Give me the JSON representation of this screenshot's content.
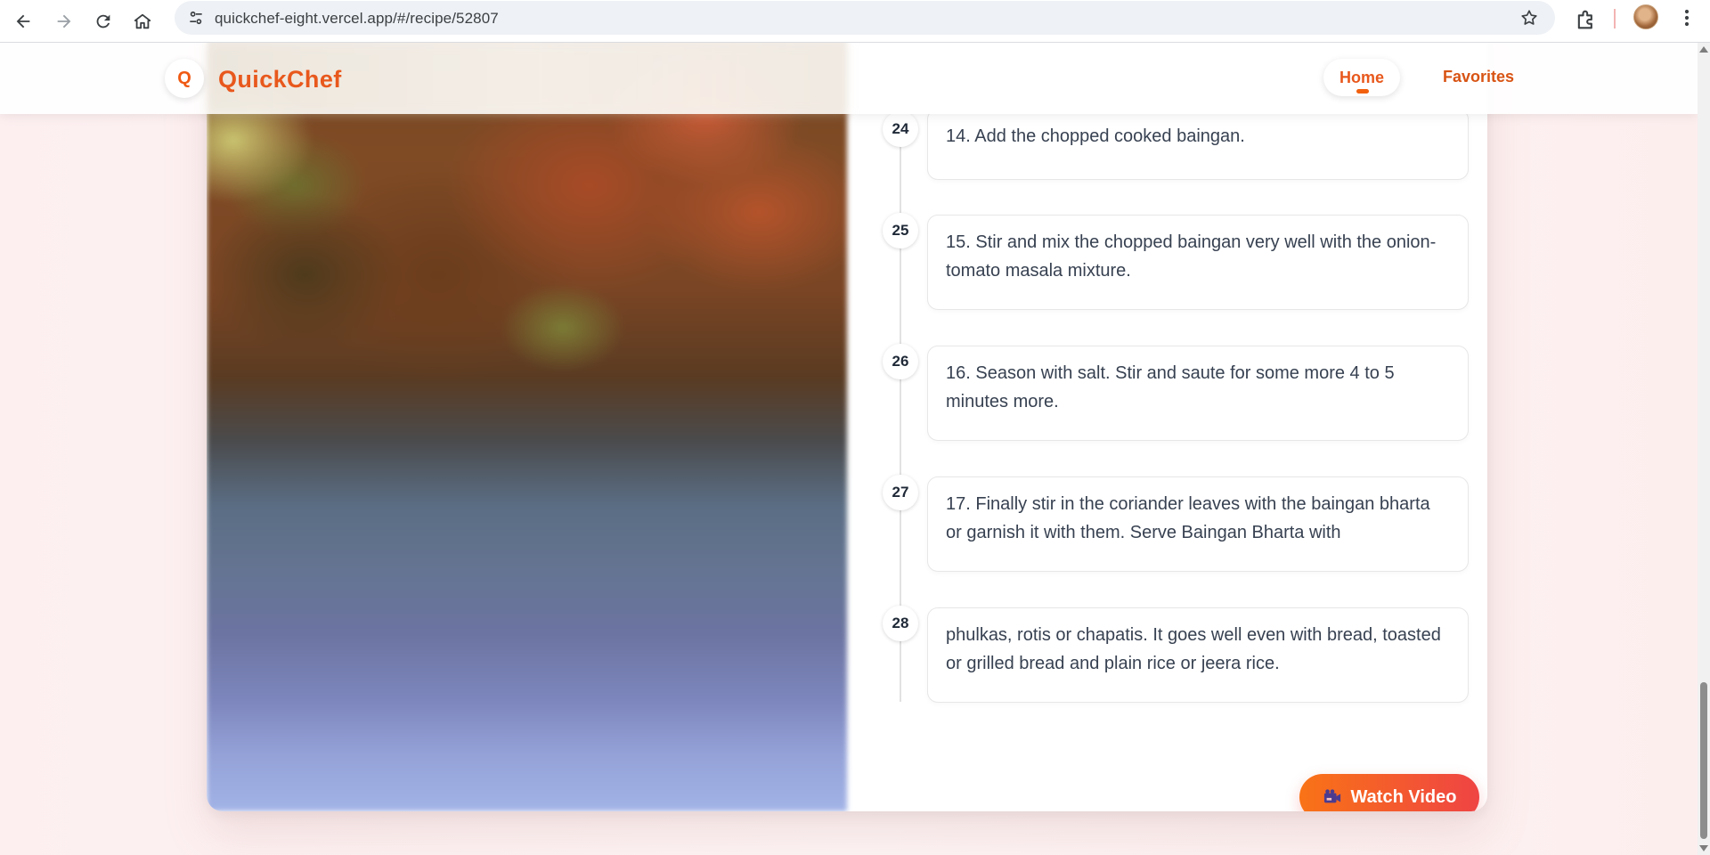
{
  "browser": {
    "url": "quickchef-eight.vercel.app/#/recipe/52807"
  },
  "header": {
    "logo_letter": "Q",
    "brand": "QuickChef",
    "nav": {
      "home": "Home",
      "favorites": "Favorites"
    },
    "accent": "#e8581c"
  },
  "steps": [
    {
      "number": "24",
      "text": "14. Add the chopped cooked baingan."
    },
    {
      "number": "25",
      "text": "15. Stir and mix the chopped baingan very well with the onion-tomato masala mixture."
    },
    {
      "number": "26",
      "text": "16. Season with salt. Stir and saute for some more 4 to 5 minutes more."
    },
    {
      "number": "27",
      "text": "17. Finally stir in the coriander leaves with the baingan bharta or garnish it with them. Serve Baingan Bharta with"
    },
    {
      "number": "28",
      "text": "phulkas, rotis or chapatis. It goes well even with bread, toasted or grilled bread and plain rice or jeera rice."
    }
  ],
  "actions": {
    "watch_video": "Watch Video"
  },
  "icons": {
    "back": "back-arrow-icon",
    "forward": "forward-arrow-icon",
    "reload": "reload-icon",
    "home": "home-icon",
    "site_info": "tune-icon",
    "bookmark": "star-icon",
    "extensions": "puzzle-icon",
    "menu": "kebab-menu-icon",
    "video": "video-camera-icon"
  }
}
